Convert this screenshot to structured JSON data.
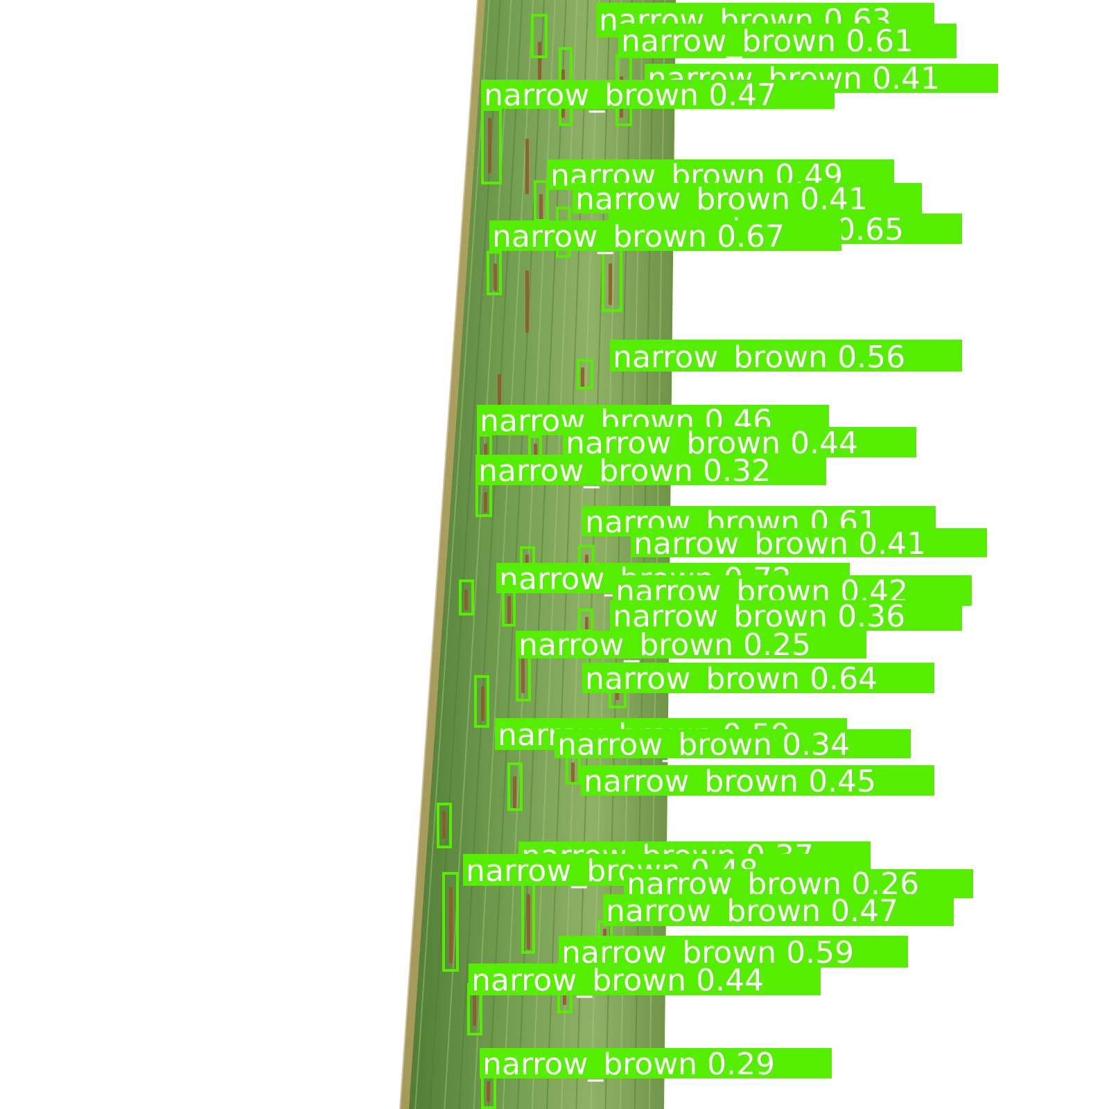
{
  "image": {
    "subject": "rice leaf with narrow brown spot lesions",
    "background_color": "#ffffff",
    "leaf_color": "#6f9a4e",
    "lesion_color": "#8a5a2a",
    "box_color": "#55ee00",
    "label_text_color": "#ffffff"
  },
  "detections": [
    {
      "label": "narrow_brown",
      "score": "0.63"
    },
    {
      "label": "narrow_brown",
      "score": "0.61"
    },
    {
      "label": "narrow_brown",
      "score": "0.41"
    },
    {
      "label": "narrow_brown",
      "score": "0.47"
    },
    {
      "label": "narrow_brown",
      "score": "0.49"
    },
    {
      "label": "narrow_brown",
      "score": "0.41"
    },
    {
      "label": "narrow_brown",
      "score": "0.65"
    },
    {
      "label": "narrow_brown",
      "score": "0.67"
    },
    {
      "label": "narrow_brown",
      "score": "0.56"
    },
    {
      "label": "narrow_brown",
      "score": "0.46"
    },
    {
      "label": "narrow_brown",
      "score": "0.44"
    },
    {
      "label": "narrow_brown",
      "score": "0.32"
    },
    {
      "label": "narrow_brown",
      "score": "0.61"
    },
    {
      "label": "narrow_brown",
      "score": "0.41"
    },
    {
      "label": "narrow_brown",
      "score": "0.72"
    },
    {
      "label": "narrow_brown",
      "score": "0.42"
    },
    {
      "label": "narrow_brown",
      "score": "0.36"
    },
    {
      "label": "narrow_brown",
      "score": "0.25"
    },
    {
      "label": "narrow_brown",
      "score": "0.64"
    },
    {
      "label": "narrow_brown",
      "score": "0.59"
    },
    {
      "label": "narrow_brown",
      "score": "0.34"
    },
    {
      "label": "narrow_brown",
      "score": "0.45"
    },
    {
      "label": "narrow_brown",
      "score": "0.37"
    },
    {
      "label": "narrow_brown",
      "score": "0.48"
    },
    {
      "label": "narrow_brown",
      "score": "0.26"
    },
    {
      "label": "narrow_brown",
      "score": "0.47"
    },
    {
      "label": "narrow_brown",
      "score": "0.59"
    },
    {
      "label": "narrow_brown",
      "score": "0.44"
    },
    {
      "label": "narrow_brown",
      "score": "0.29"
    }
  ]
}
